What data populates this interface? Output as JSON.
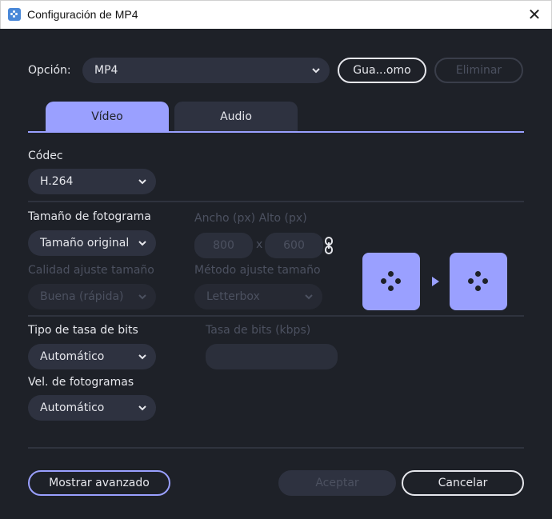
{
  "window": {
    "title": "Configuración de MP4"
  },
  "option": {
    "label": "Opción:",
    "selected": "MP4",
    "save_button": "Gua...omo",
    "delete_button": "Eliminar"
  },
  "tabs": [
    {
      "label": "Vídeo",
      "active": true
    },
    {
      "label": "Audio",
      "active": false
    }
  ],
  "codec": {
    "label": "Códec",
    "selected": "H.264"
  },
  "frame_size": {
    "label": "Tamaño de fotograma",
    "selected": "Tamaño original",
    "width_height_label": "Ancho (px) Alto (px)",
    "width": "800",
    "separator": "x",
    "height": "600"
  },
  "resize_quality": {
    "label": "Calidad ajuste tamaño",
    "selected": "Buena (rápida)"
  },
  "resize_method": {
    "label": "Método ajuste tamaño",
    "selected": "Letterbox"
  },
  "bitrate_type": {
    "label": "Tipo de tasa de bits",
    "selected": "Automático"
  },
  "bitrate": {
    "label": "Tasa de bits (kbps)",
    "value": ""
  },
  "framerate": {
    "label": "Vel. de fotogramas",
    "selected": "Automático"
  },
  "footer": {
    "advanced_button": "Mostrar avanzado",
    "accept_button": "Aceptar",
    "cancel_button": "Cancelar"
  },
  "colors": {
    "accent": "#9aa0ff",
    "background": "#1e2128",
    "control": "#2e3240"
  },
  "icons": [
    "app-icon",
    "close-icon",
    "chevron-down-icon",
    "link-icon",
    "preview-icon",
    "arrow-right-icon"
  ]
}
